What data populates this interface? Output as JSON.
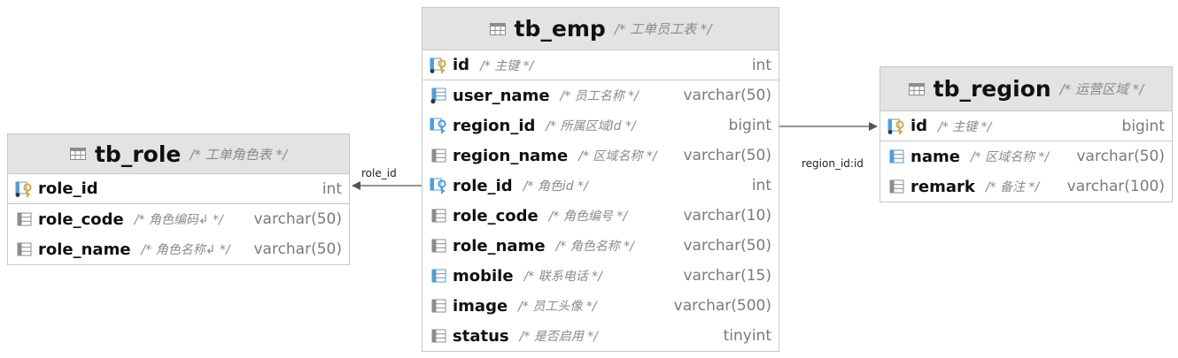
{
  "tables": {
    "tb_role": {
      "name": "tb_role",
      "comment": "/* 工单角色表 */",
      "columns": [
        {
          "name": "role_id",
          "comment": "",
          "type": "int",
          "kind": "pk"
        },
        {
          "name": "role_code",
          "comment": "/* 角色编码↲ */",
          "type": "varchar(50)",
          "kind": "col"
        },
        {
          "name": "role_name",
          "comment": "/* 角色名称↲ */",
          "type": "varchar(50)",
          "kind": "col"
        }
      ]
    },
    "tb_emp": {
      "name": "tb_emp",
      "comment": "/* 工单员工表 */",
      "columns": [
        {
          "name": "id",
          "comment": "/* 主键 */",
          "type": "int",
          "kind": "pk"
        },
        {
          "name": "user_name",
          "comment": "/* 员工名称 */",
          "type": "varchar(50)",
          "kind": "idx"
        },
        {
          "name": "region_id",
          "comment": "/* 所属区域Id */",
          "type": "bigint",
          "kind": "fk"
        },
        {
          "name": "region_name",
          "comment": "/* 区域名称 */",
          "type": "varchar(50)",
          "kind": "col"
        },
        {
          "name": "role_id",
          "comment": "/* 角色id */",
          "type": "int",
          "kind": "fk"
        },
        {
          "name": "role_code",
          "comment": "/* 角色编号 */",
          "type": "varchar(10)",
          "kind": "col"
        },
        {
          "name": "role_name",
          "comment": "/* 角色名称 */",
          "type": "varchar(50)",
          "kind": "col"
        },
        {
          "name": "mobile",
          "comment": "/* 联系电话 */",
          "type": "varchar(15)",
          "kind": "col-blue"
        },
        {
          "name": "image",
          "comment": "/* 员工头像 */",
          "type": "varchar(500)",
          "kind": "col"
        },
        {
          "name": "status",
          "comment": "/* 是否启用 */",
          "type": "tinyint",
          "kind": "col"
        }
      ]
    },
    "tb_region": {
      "name": "tb_region",
      "comment": "/* 运营区域 */",
      "columns": [
        {
          "name": "id",
          "comment": "/* 主键 */",
          "type": "bigint",
          "kind": "pk"
        },
        {
          "name": "name",
          "comment": "/* 区域名称 */",
          "type": "varchar(50)",
          "kind": "col-blue"
        },
        {
          "name": "remark",
          "comment": "/* 备注 */",
          "type": "varchar(100)",
          "kind": "col"
        }
      ]
    }
  },
  "relations": {
    "emp_role": {
      "label": "role_id"
    },
    "emp_region": {
      "label": "region_id:id"
    }
  },
  "colors": {
    "header_bg": "#e3e3e3",
    "border": "#c8c8c8",
    "column_icon": "#4f9fd6",
    "key_icon": "#e0a82e",
    "link_line": "#555555"
  }
}
